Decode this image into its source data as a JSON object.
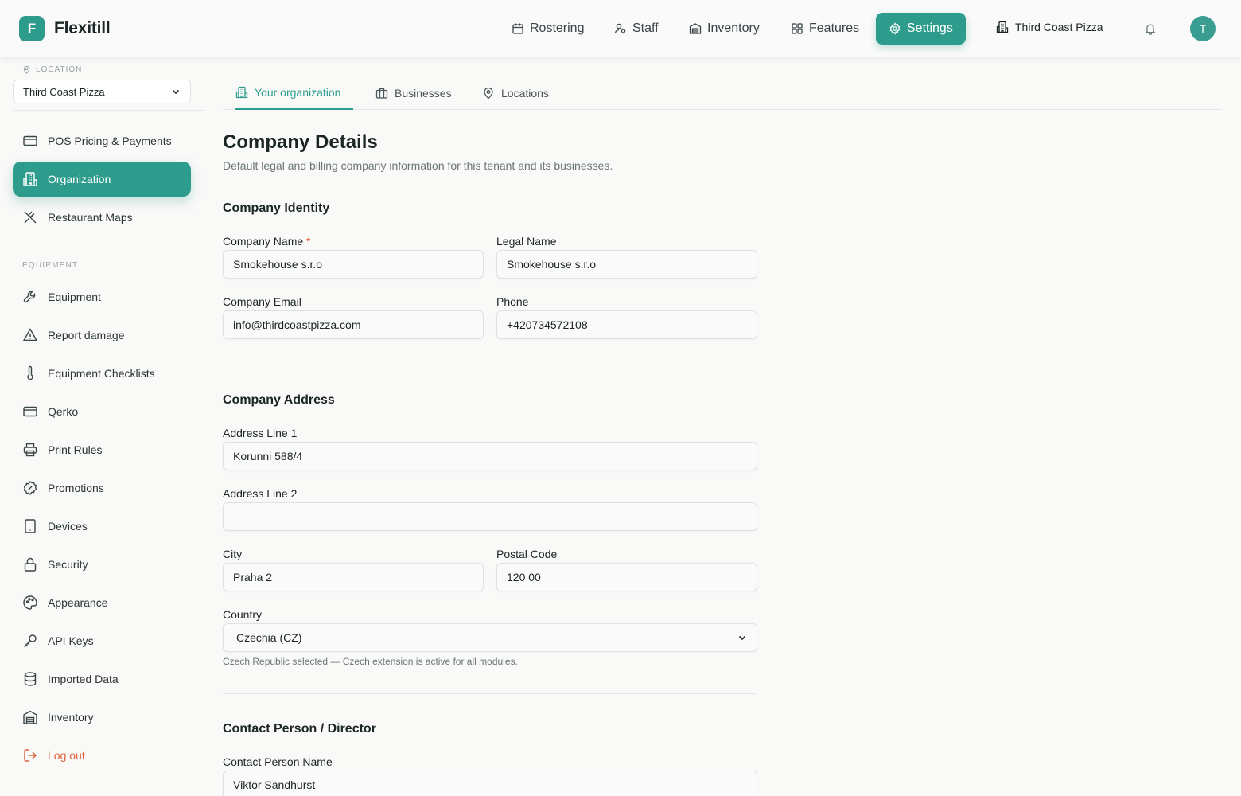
{
  "header": {
    "logo_letter": "F",
    "brand": "Flexitill",
    "nav": {
      "rostering": "Rostering",
      "staff": "Staff",
      "inventory": "Inventory",
      "features": "Features",
      "settings": "Settings"
    },
    "org_name": "Third Coast Pizza",
    "avatar_initial": "T"
  },
  "sidebar": {
    "location_label": "LOCATION",
    "location_value": "Third Coast Pizza",
    "items": {
      "pos": "POS Pricing & Payments",
      "organization": "Organization",
      "maps": "Restaurant Maps"
    },
    "equipment_section": "EQUIPMENT",
    "equipment_items": {
      "equipment": "Equipment",
      "damage": "Report damage",
      "checklists": "Equipment Checklists",
      "qerko": "Qerko",
      "print": "Print Rules",
      "promotions": "Promotions",
      "devices": "Devices",
      "security": "Security",
      "appearance": "Appearance",
      "api": "API Keys",
      "imported": "Imported Data",
      "inventory": "Inventory",
      "logout": "Log out"
    }
  },
  "tabs": {
    "org": "Your organization",
    "businesses": "Businesses",
    "locations": "Locations"
  },
  "page": {
    "title": "Company Details",
    "subtitle": "Default legal and billing company information for this tenant and its businesses."
  },
  "identity": {
    "title": "Company Identity",
    "company_name_label": "Company Name",
    "required_mark": "*",
    "company_name": "Smokehouse s.r.o",
    "legal_name_label": "Legal Name",
    "legal_name": "Smokehouse s.r.o",
    "email_label": "Company Email",
    "email": "info@thirdcoastpizza.com",
    "phone_label": "Phone",
    "phone": "+420734572108"
  },
  "address": {
    "title": "Company Address",
    "line1_label": "Address Line 1",
    "line1": "Korunni 588/4",
    "line2_label": "Address Line 2",
    "line2": "",
    "city_label": "City",
    "city": "Praha 2",
    "postal_label": "Postal Code",
    "postal": "120 00",
    "country_label": "Country",
    "country": "Czechia (CZ)",
    "country_hint": "Czech Republic selected — Czech extension is active for all modules."
  },
  "contact": {
    "title": "Contact Person / Director",
    "name_label": "Contact Person Name",
    "name": "Viktor Sandhurst"
  },
  "colors": {
    "accent": "#2e9c8c",
    "danger": "#e0603c",
    "background": "#f9f9f8"
  }
}
